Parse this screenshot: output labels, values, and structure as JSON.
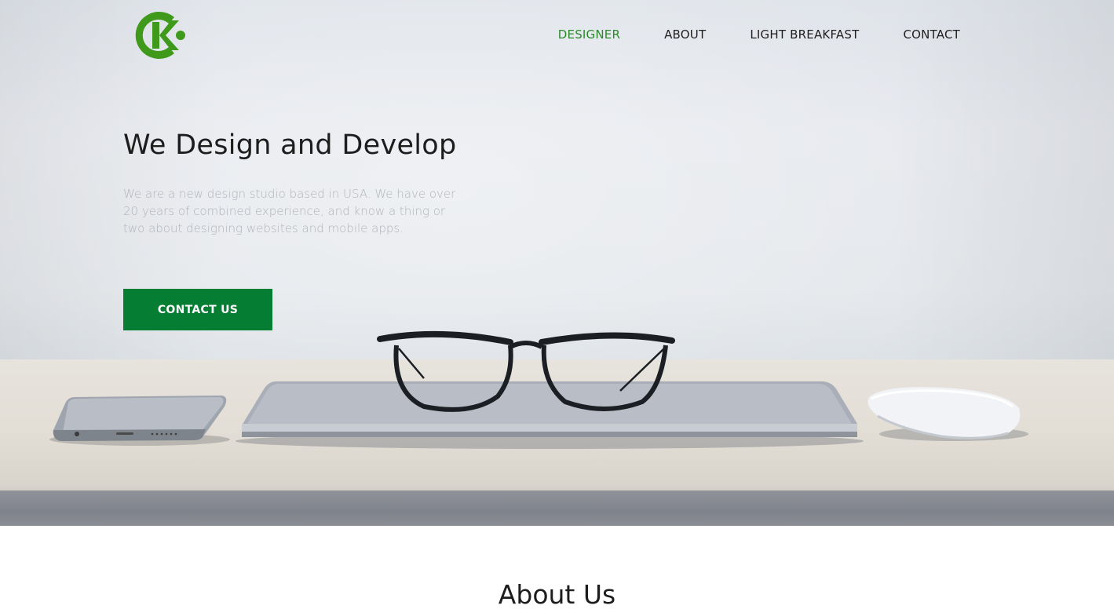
{
  "brand": {
    "logo_icon": "ck-logo-icon",
    "color": "#3f9a1c"
  },
  "nav": {
    "items": [
      {
        "label": "DESIGNER",
        "active": true
      },
      {
        "label": "ABOUT",
        "active": false
      },
      {
        "label": "LIGHT BREAKFAST",
        "active": false
      },
      {
        "label": "CONTACT",
        "active": false
      }
    ]
  },
  "hero": {
    "title": "We Design and Develop",
    "text": "We are a new design studio based in USA. We have over 20 years of combined experience, and know a thing or two about designing websites and mobile apps.",
    "cta_label": "CONTACT US",
    "cta_color": "#057d33",
    "image_items": [
      "phone",
      "laptop",
      "glasses",
      "mouse"
    ]
  },
  "about": {
    "title": "About Us"
  }
}
